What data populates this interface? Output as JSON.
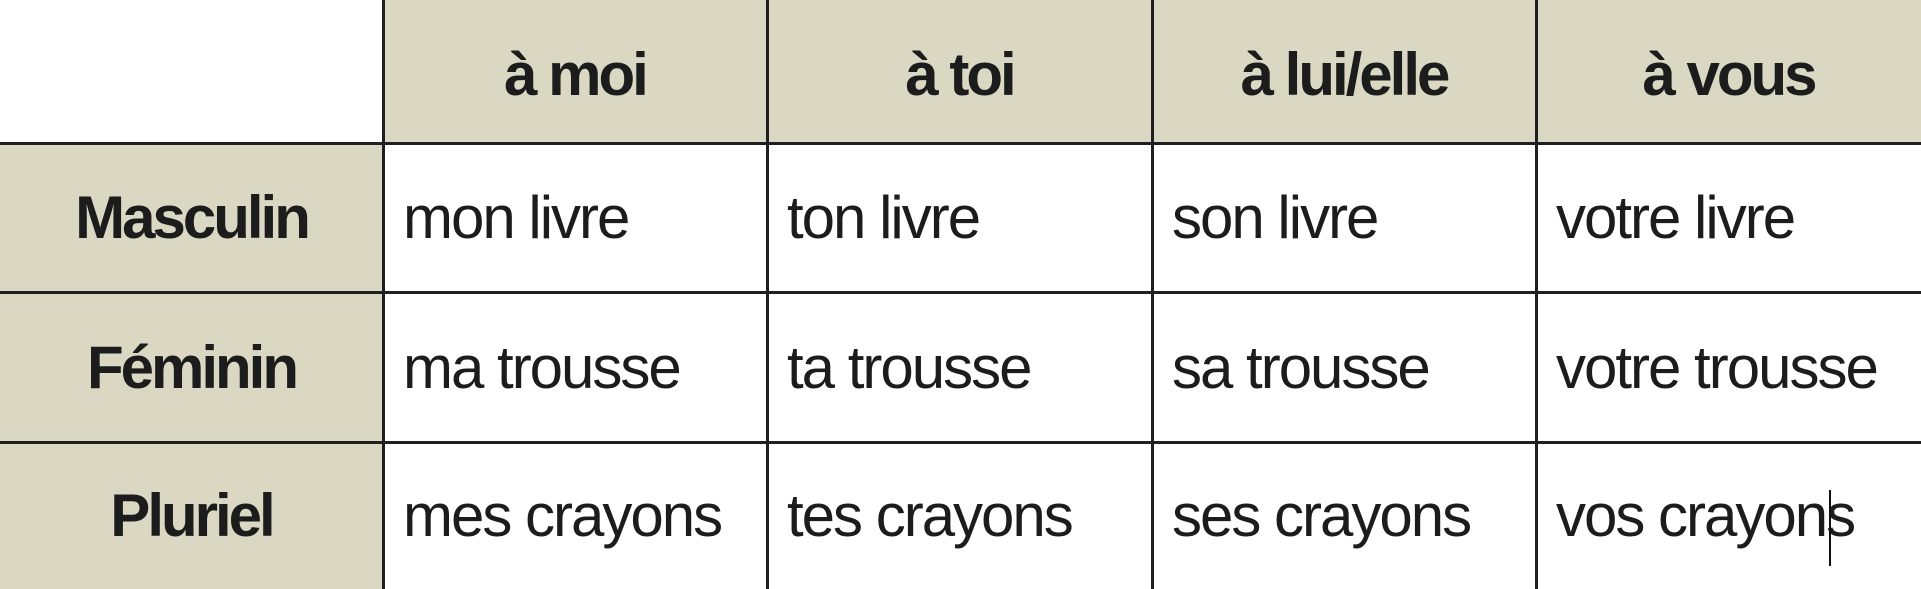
{
  "colors": {
    "header_bg": "#dad8c3",
    "cell_bg": "#ffffff",
    "border": "#1f1f1f",
    "text": "#1c1c1c"
  },
  "table": {
    "columns": [
      "à moi",
      "à toi",
      "à lui/elle",
      "à vous"
    ],
    "rows": [
      {
        "label": "Masculin",
        "cells": [
          "mon livre",
          "ton livre",
          "son livre",
          "votre livre"
        ]
      },
      {
        "label": "Féminin",
        "cells": [
          "ma trousse",
          "ta trousse",
          "sa trousse",
          "votre trousse"
        ]
      },
      {
        "label": "Pluriel",
        "cells": [
          "mes crayons",
          "tes crayons",
          "ses crayons",
          "vos crayons"
        ]
      }
    ]
  }
}
